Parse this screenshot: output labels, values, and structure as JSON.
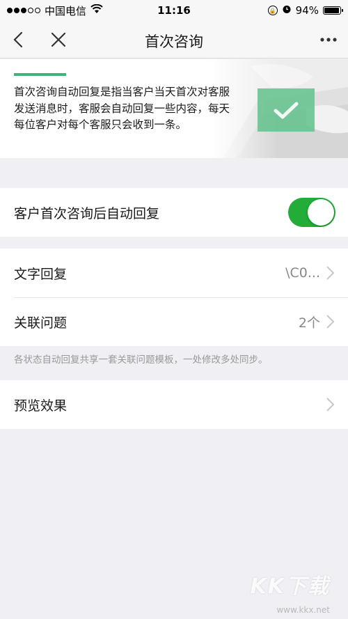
{
  "status_bar": {
    "carrier": "中国电信",
    "time": "11:16",
    "battery": "94%",
    "battery_level": 0.94
  },
  "nav": {
    "title": "首次咨询"
  },
  "intro": {
    "text": "首次咨询自动回复是指当客户当天首次对客服发送消息时，客服会自动回复一些内容，每天每位客户对每个客服只会收到一条。",
    "accent_color": "#3cb77a"
  },
  "auto_reply_toggle": {
    "label": "客户首次咨询后自动回复",
    "enabled": true,
    "on_color": "#22ac38"
  },
  "settings": {
    "text_reply": {
      "label": "文字回复",
      "value": "\\C0..."
    },
    "related_questions": {
      "label": "关联问题",
      "value": "2个"
    }
  },
  "note": "各状态自动回复共享一套关联问题模板，一处修改多处同步。",
  "preview": {
    "label": "预览效果"
  },
  "watermark": {
    "text": "KK下载",
    "url": "www.kkx.net"
  }
}
